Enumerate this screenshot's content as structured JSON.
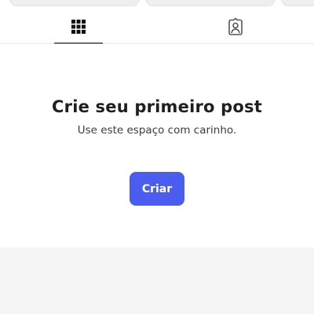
{
  "tabs": [
    {
      "id": "grid",
      "icon": "grid-icon",
      "active": true
    },
    {
      "id": "tagged",
      "icon": "tagged-person-icon",
      "active": false
    }
  ],
  "empty_state": {
    "title": "Crie seu primeiro post",
    "subtitle": "Use este espaço com carinho.",
    "button_label": "Criar"
  },
  "colors": {
    "accent": "#4b5cf0",
    "tab_indicator": "#6f6f6f",
    "bottom_background": "#f5f5f5"
  }
}
